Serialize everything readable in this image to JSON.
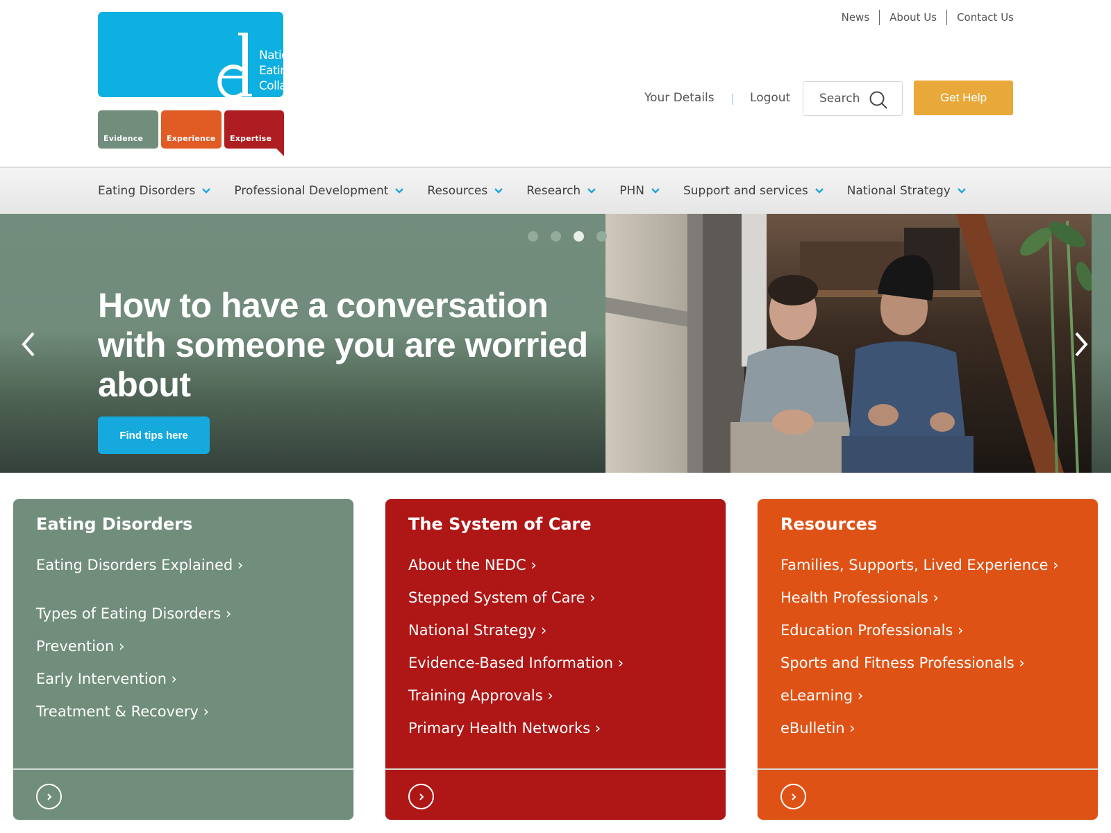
{
  "logo": {
    "lines": [
      "National",
      "Eating Disorders",
      "Collaboration"
    ],
    "tags": [
      "Evidence",
      "Experience",
      "Expertise"
    ],
    "colors": {
      "blue": "#0db0e0",
      "green": "#718d7b",
      "orange": "#e15b25",
      "red": "#ae1d21"
    }
  },
  "utility_nav": [
    "News",
    "About Us",
    "Contact Us"
  ],
  "account": {
    "your_details": "Your Details",
    "separator": "|",
    "logout": "Logout"
  },
  "search": {
    "placeholder": "Search",
    "icon": "search-icon"
  },
  "get_help": {
    "label": "Get Help",
    "color": "#e8a93a"
  },
  "main_nav": [
    {
      "label": "Eating Disorders",
      "icon": "chevron-down-icon"
    },
    {
      "label": "Professional Development",
      "icon": "chevron-down-icon"
    },
    {
      "label": "Resources",
      "icon": "chevron-down-icon"
    },
    {
      "label": "Research",
      "icon": "chevron-down-icon"
    },
    {
      "label": "PHN",
      "icon": "chevron-down-icon"
    },
    {
      "label": "Support and services",
      "icon": "chevron-down-icon"
    },
    {
      "label": "National Strategy",
      "icon": "chevron-down-icon"
    }
  ],
  "hero": {
    "title": "How to have a conversation with someone you are worried about",
    "button": "Find tips here",
    "slide_count": 4,
    "active_slide": 3,
    "prev_icon": "chevron-left-icon",
    "next_icon": "chevron-right-icon",
    "image_alt": "Two men sitting on stairs talking"
  },
  "cards": [
    {
      "title": "Eating Disorders",
      "color": "#718d7b",
      "links": [
        "Eating Disorders Explained ›",
        "Types of Eating Disorders ›",
        "Prevention ›",
        "Early Intervention ›",
        "Treatment & Recovery ›"
      ]
    },
    {
      "title": "The System of Care",
      "color": "#ae1716",
      "links": [
        "About the NEDC ›",
        "Stepped System of Care ›",
        "National Strategy ›",
        "Evidence-Based Information ›",
        "Training Approvals ›",
        "Primary Health Networks ›"
      ]
    },
    {
      "title": "Resources",
      "color": "#df5215",
      "links": [
        "Families, Supports, Lived Experience ›",
        "Health Professionals ›",
        "Education Professionals ›",
        "Sports and Fitness Professionals ›",
        "eLearning ›",
        "eBulletin ›"
      ]
    }
  ]
}
